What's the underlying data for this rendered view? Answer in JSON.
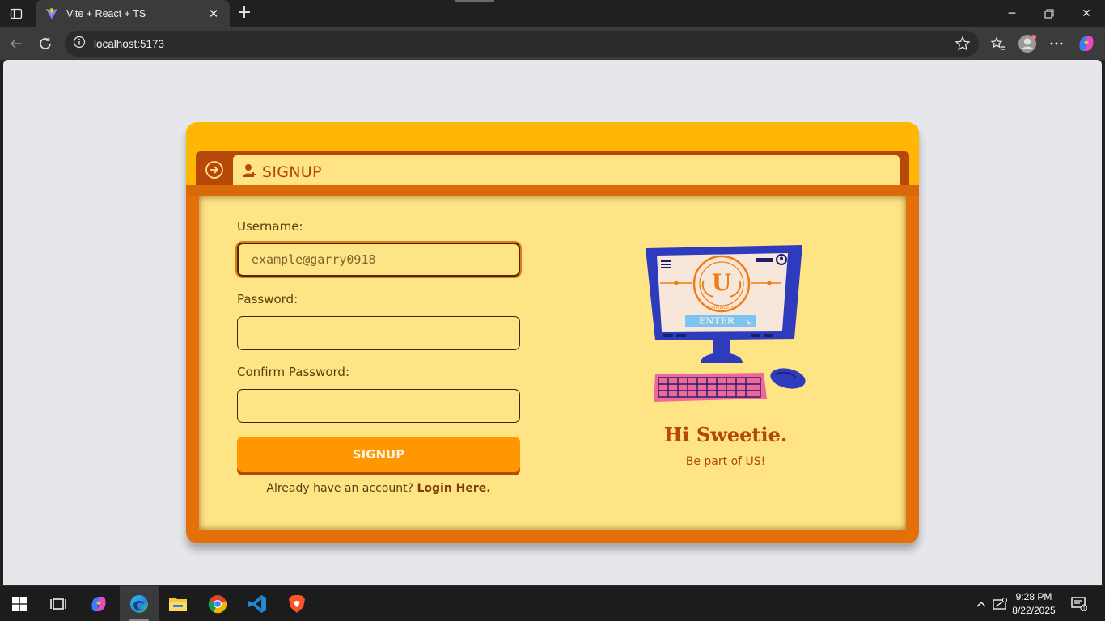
{
  "browser": {
    "tab_title": "Vite + React + TS",
    "url": "localhost:5173"
  },
  "page": {
    "header_title": "SIGNUP",
    "form": {
      "username_label": "Username:",
      "username_placeholder": "example@garry0918",
      "password_label": "Password:",
      "password_value": "",
      "confirm_label": "Confirm Password:",
      "confirm_value": "",
      "submit_label": "SIGNUP",
      "footer_prefix": "Already have an account?",
      "footer_link": "Login Here."
    },
    "illustration": {
      "button_text": "ENTER",
      "seal_letter": "U",
      "seal_caption": "UNIVERSITY"
    },
    "greeting": "Hi Sweetie.",
    "subgreeting": "Be part of US!"
  },
  "colors": {
    "card_yellow": "#ffb703",
    "panel_orange": "#e5700a",
    "header_brown": "#b8470a",
    "panel_cream": "#ffe485",
    "button_orange": "#ff9800",
    "accent_text": "#b5470b"
  },
  "taskbar": {
    "time": "9:28 PM",
    "date": "8/22/2025",
    "notification_count": "1",
    "apps": [
      "start-icon",
      "task-view-icon",
      "copilot-icon",
      "edge-icon",
      "file-explorer-icon",
      "chrome-icon",
      "vscode-icon",
      "brave-icon"
    ]
  }
}
